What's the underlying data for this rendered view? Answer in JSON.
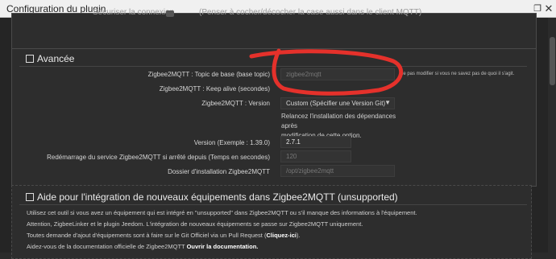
{
  "window": {
    "title": "Configuration du plugin",
    "maximize_glyph": "❐",
    "close_glyph": "✕"
  },
  "top_panel": {
    "label": "Sécuriser la connexion",
    "note": "(Penser à cocher/décocher la case aussi dans le client MQTT)"
  },
  "advanced": {
    "title": "Avancée",
    "fields": {
      "base_topic": {
        "label": "Zigbee2MQTT : Topic de base (base topic)",
        "placeholder": "zigbee2mqtt",
        "note": "Ne pas modifier si vous ne savez pas de quoi il s'agit."
      },
      "keep_alive": {
        "label": "Zigbee2MQTT : Keep alive (secondes)"
      },
      "version": {
        "label": "Zigbee2MQTT : Version",
        "selected": "Custom (Spécifier une Version Git)",
        "info_line1": "Relancez l'installation des dépendances après",
        "info_line2": "modification de cette option."
      },
      "version_example": {
        "label": "Version (Exemple : 1.39.0)",
        "value": "2.7.1"
      },
      "restart": {
        "label": "Redémarrage du service Zigbee2MQTT si arrêté depuis (Temps en secondes)",
        "placeholder": "120"
      },
      "install_dir": {
        "label": "Dossier d'installation Zigbee2MQTT",
        "placeholder": "/opt/zigbee2mqtt"
      }
    }
  },
  "help": {
    "title": "Aide pour l'intégration de nouveaux équipements dans Zigbee2MQTT (unsupported)",
    "line1": "Utilisez cet outil si vous avez un équipement qui est intégré en \"unsupported\" dans Zigbee2MQTT ou s'il manque des informations à l'équipement.",
    "line2": "Attention, ZigbeeLinker et le plugin Jeedom. L'intégration de nouveaux équipements se passe sur Zigbee2MQTT uniquement.",
    "line3_prefix": "Toutes demande d'ajout d'équipements sont à faire sur le Git Officiel via un Pull Request (",
    "line3_link": "Cliquez-ici",
    "line3_suffix": ").",
    "line4_prefix": "Aidez-vous de la documentation officielle de Zigbee2MQTT ",
    "line4_link": "Ouvrir la documentation."
  },
  "colors": {
    "annotation_red": "#e5312b",
    "background": "#252525"
  }
}
